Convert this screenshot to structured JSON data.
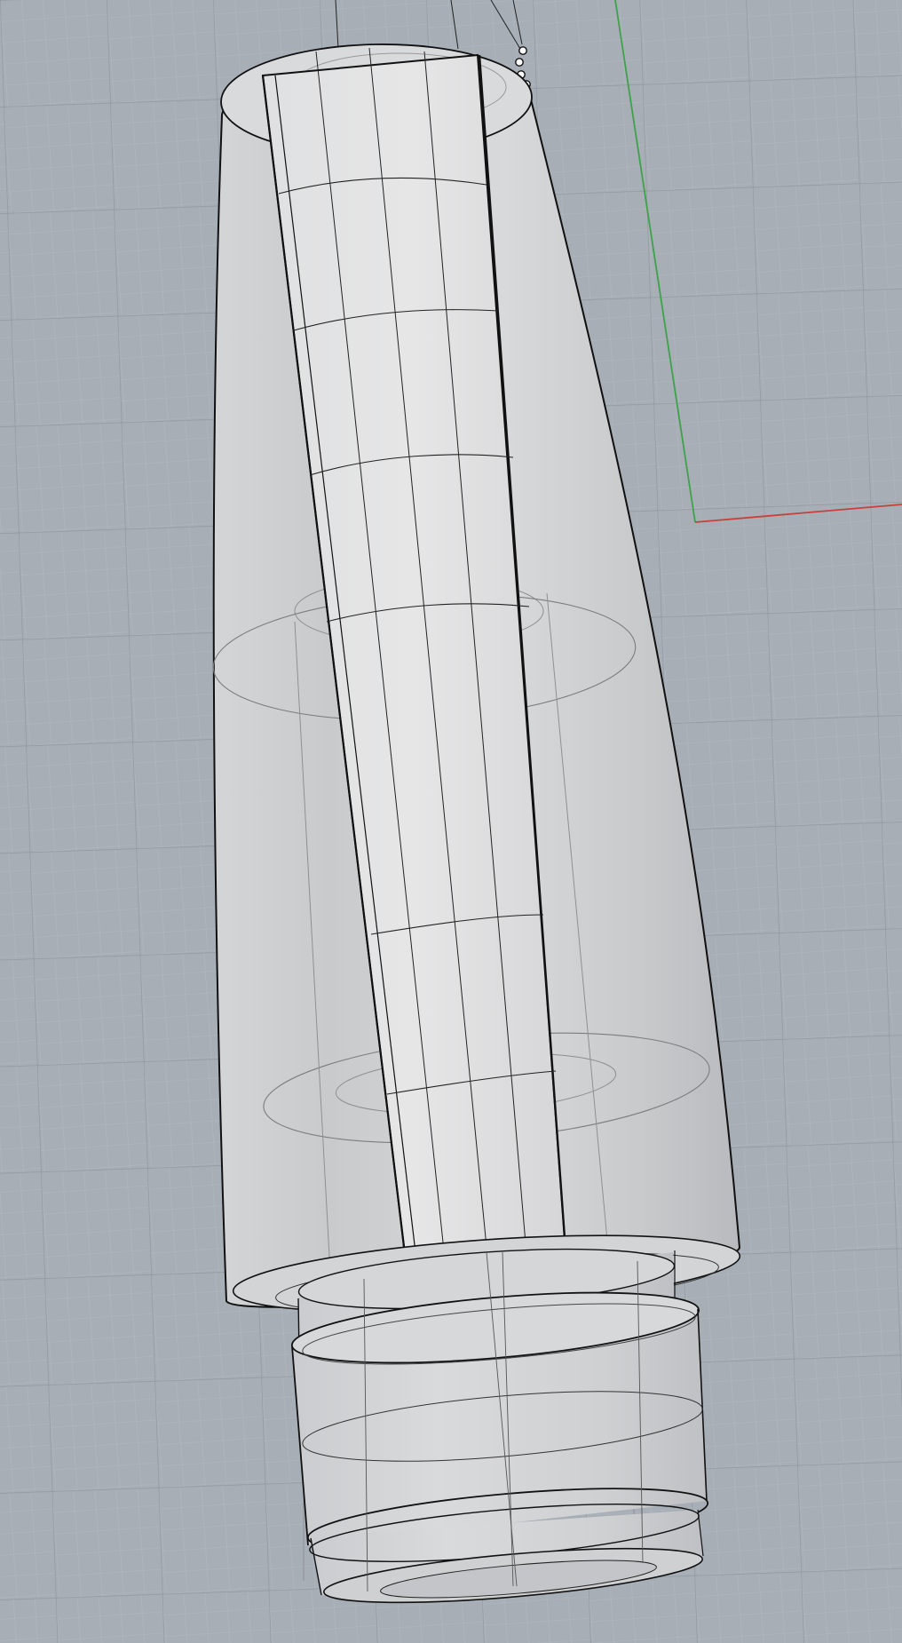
{
  "viewport": {
    "background": "#a7aeb6",
    "grid_minor_color": "#b4bac1",
    "grid_major_color": "#8f969e",
    "x_axis_color": "#c8403b",
    "y_axis_color": "#3ea24a",
    "model_outline_color": "#111111",
    "model_fill_color": "#cfd0d2"
  }
}
